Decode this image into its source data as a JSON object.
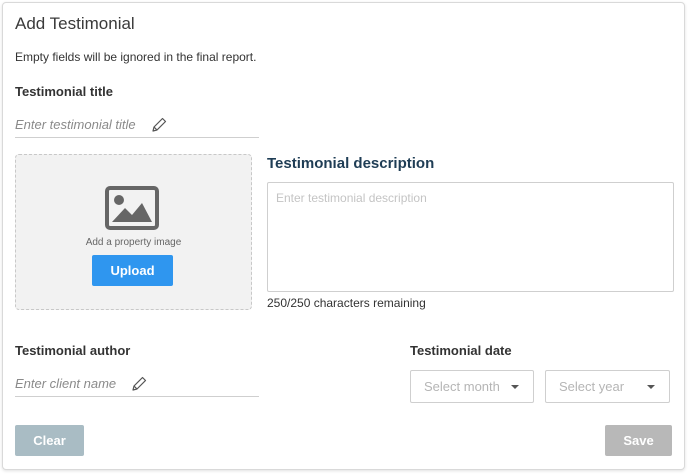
{
  "header": {
    "title": "Add Testimonial",
    "hint": "Empty fields will be ignored in the final report."
  },
  "title_field": {
    "label": "Testimonial title",
    "placeholder": "Enter testimonial title"
  },
  "image_upload": {
    "text": "Add a property image",
    "button_label": "Upload"
  },
  "description": {
    "label": "Testimonial description",
    "placeholder": "Enter testimonial description",
    "remaining": "250/250 characters remaining"
  },
  "author_field": {
    "label": "Testimonial author",
    "placeholder": "Enter client name"
  },
  "date_field": {
    "label": "Testimonial date",
    "month_placeholder": "Select month",
    "year_placeholder": "Select year"
  },
  "footer": {
    "clear_label": "Clear",
    "save_label": "Save"
  },
  "colors": {
    "upload_button": "#2f96ef",
    "clear_button": "#a9bcc4",
    "save_button": "#b8b8b8",
    "description_title": "#1f3d55"
  },
  "icons": {
    "pencil": "pencil-icon",
    "image": "image-icon",
    "caret": "chevron-down-icon"
  }
}
